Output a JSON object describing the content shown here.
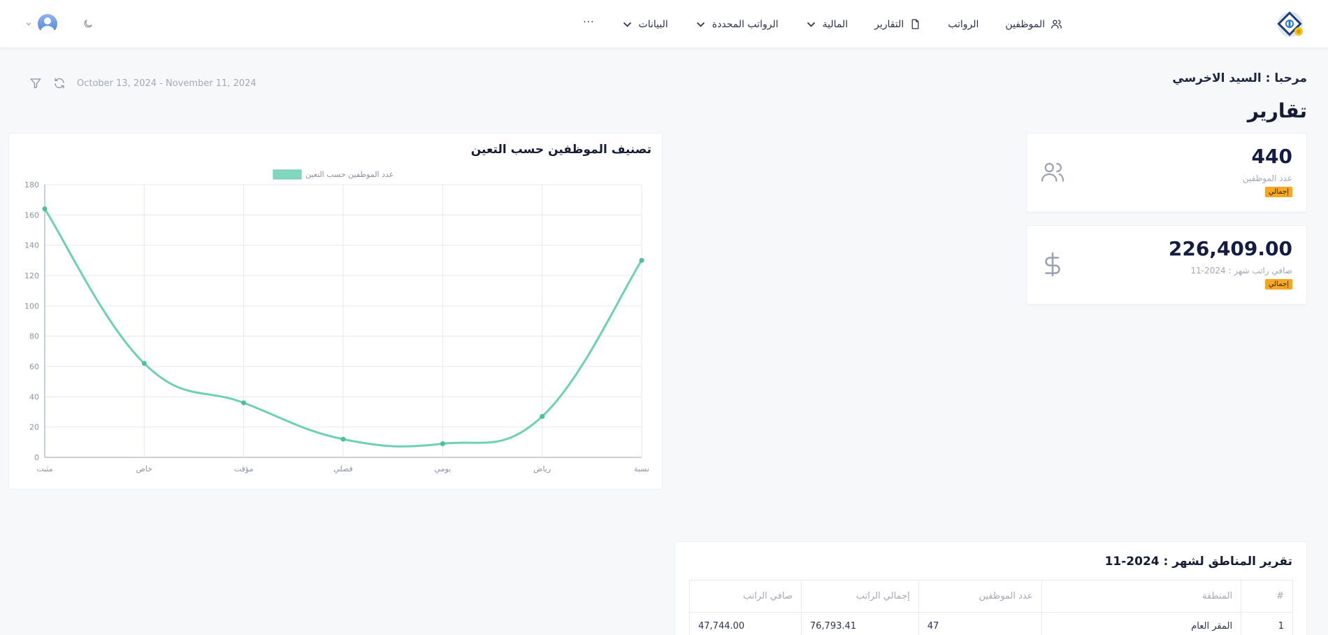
{
  "nav": {
    "items": [
      {
        "label": "الموظفين",
        "icon": "users-icon",
        "dropdown": false
      },
      {
        "label": "الرواتب",
        "icon": "",
        "dropdown": false
      },
      {
        "label": "التقارير",
        "icon": "file-icon",
        "dropdown": false
      },
      {
        "label": "المالية",
        "icon": "",
        "dropdown": true
      },
      {
        "label": "الرواتب المحددة",
        "icon": "",
        "dropdown": true
      },
      {
        "label": "البيانات",
        "icon": "",
        "dropdown": true
      }
    ],
    "more": "···"
  },
  "header": {
    "greeting": "مرحبا : السيد الاخرسي",
    "title": "تقارير",
    "date_range": "October 13, 2024 - November 11, 2024"
  },
  "stats": [
    {
      "value": "440",
      "label": "عدد الموظفين",
      "badge": "إجمالي",
      "icon": "users-icon"
    },
    {
      "value": "226,409.00",
      "label": "صافي راتب شهر : 2024-11",
      "badge": "إجمالي",
      "icon": "dollar-icon"
    }
  ],
  "chart_data": {
    "type": "line",
    "title": "تصنيف الموظفين حسب التعين",
    "categories": [
      "مثبت",
      "خاص",
      "مؤقت",
      "فصلي",
      "يومي",
      "رياض",
      "نسبة"
    ],
    "series": [
      {
        "name": "عدد الموظفين حسب التعين",
        "values": [
          164,
          62,
          36,
          12,
          9,
          27,
          130
        ],
        "color": "#6dd1b3"
      }
    ],
    "ylim": [
      0,
      180
    ],
    "yticks": [
      0,
      20,
      40,
      60,
      80,
      100,
      120,
      140,
      160,
      180
    ],
    "grid": true,
    "legend": "top-center"
  },
  "region_table": {
    "title": "تقرير المناطق لشهر : 2024-11",
    "headers": [
      "#",
      "المنطقة",
      "عدد الموظفين",
      "إجمالي الراتب",
      "صافي الراتب"
    ],
    "rows": [
      [
        "1",
        "المقر العام",
        "47",
        "76,793.41",
        "47,744.00"
      ]
    ]
  },
  "colors": {
    "accent": "#6dd1b3",
    "badge": "#f5a623",
    "title": "#141c36"
  }
}
